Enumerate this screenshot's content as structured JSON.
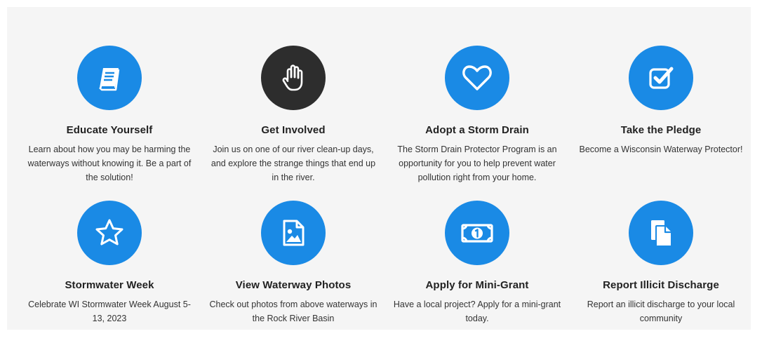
{
  "colors": {
    "accent": "#1a8ae5",
    "active": "#2d2d2d",
    "background": "#f5f5f5"
  },
  "cards": [
    {
      "icon": "book-icon",
      "title": "Educate Yourself",
      "desc": "Learn about how you may be harming the waterways without knowing it. Be a part of the solution!"
    },
    {
      "icon": "hand-icon",
      "title": "Get Involved",
      "desc": "Join us on one of our river clean-up days, and explore the strange things that end up in the river."
    },
    {
      "icon": "heart-icon",
      "title": "Adopt a Storm Drain",
      "desc": "The Storm Drain Protector Program is an opportunity for you to help prevent water pollution right from your home."
    },
    {
      "icon": "checkbox-icon",
      "title": "Take the Pledge",
      "desc": "Become a Wisconsin Waterway Protector!"
    },
    {
      "icon": "star-icon",
      "title": "Stormwater Week",
      "desc": "Celebrate WI Stormwater Week August 5-13, 2023"
    },
    {
      "icon": "photo-icon",
      "title": "View Waterway Photos",
      "desc": "Check out photos from above waterways in the Rock River Basin"
    },
    {
      "icon": "money-icon",
      "title": "Apply for Mini-Grant",
      "desc": "Have a local project? Apply for a mini-grant today."
    },
    {
      "icon": "documents-icon",
      "title": "Report Illicit Discharge",
      "desc": "Report an illicit discharge to your local community"
    }
  ]
}
